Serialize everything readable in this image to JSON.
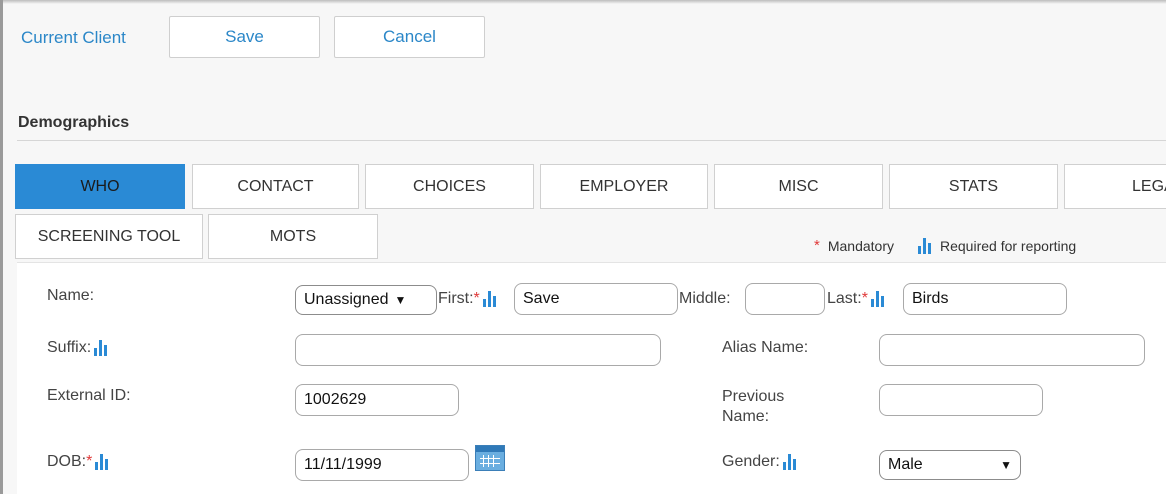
{
  "header": {
    "current_client": "Current Client",
    "save_label": "Save",
    "cancel_label": "Cancel"
  },
  "section": {
    "title": "Demographics"
  },
  "tabs": [
    {
      "label": "WHO",
      "active": true
    },
    {
      "label": "CONTACT",
      "active": false
    },
    {
      "label": "CHOICES",
      "active": false
    },
    {
      "label": "EMPLOYER",
      "active": false
    },
    {
      "label": "MISC",
      "active": false
    },
    {
      "label": "STATS",
      "active": false
    },
    {
      "label": "LEGAL",
      "active": false
    },
    {
      "label": "SCREENING TOOL",
      "active": false
    },
    {
      "label": "MOTS",
      "active": false
    }
  ],
  "legend": {
    "mandatory_symbol": "*",
    "mandatory": "Mandatory",
    "required": "Required for reporting"
  },
  "form": {
    "name_label": "Name:",
    "name_prefix_value": "Unassigned",
    "first_label": "First:",
    "first_value": "Save",
    "middle_label": "Middle:",
    "middle_value": "",
    "last_label": "Last:",
    "last_value": "Birds",
    "suffix_label": "Suffix:",
    "suffix_value": "",
    "alias_label": "Alias Name:",
    "alias_value": "",
    "external_id_label": "External ID:",
    "external_id_value": "1002629",
    "previous_name_label": "Previous Name:",
    "previous_name_value": "",
    "dob_label": "DOB:",
    "dob_value": "11/11/1999",
    "gender_label": "Gender:",
    "gender_value": "Male"
  },
  "colors": {
    "accent": "#2a8ad5",
    "link": "#2b87c8",
    "required": "#e03a3a"
  },
  "icons": [
    "bar-chart-icon",
    "calendar-icon",
    "chevron-down-icon"
  ]
}
